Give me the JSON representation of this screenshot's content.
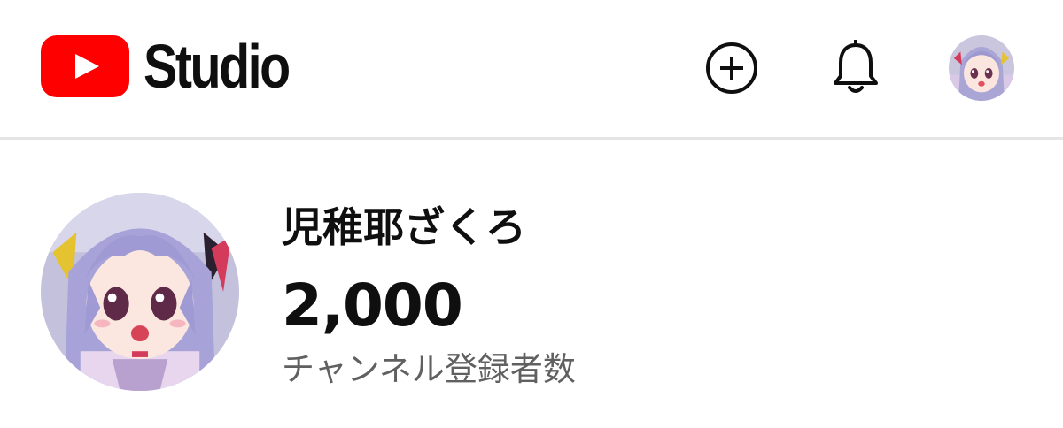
{
  "header": {
    "logo_icon": "youtube-play-icon",
    "logo_text": "Studio",
    "create_icon": "add-circle-icon",
    "notifications_icon": "bell-icon",
    "account_avatar": "account-avatar",
    "brand_color": "#ff0000"
  },
  "channel": {
    "avatar": "channel-avatar",
    "name": "児稚耶ざくろ",
    "subscriber_count": "2,000",
    "subscriber_label": "チャンネル登録者数"
  }
}
